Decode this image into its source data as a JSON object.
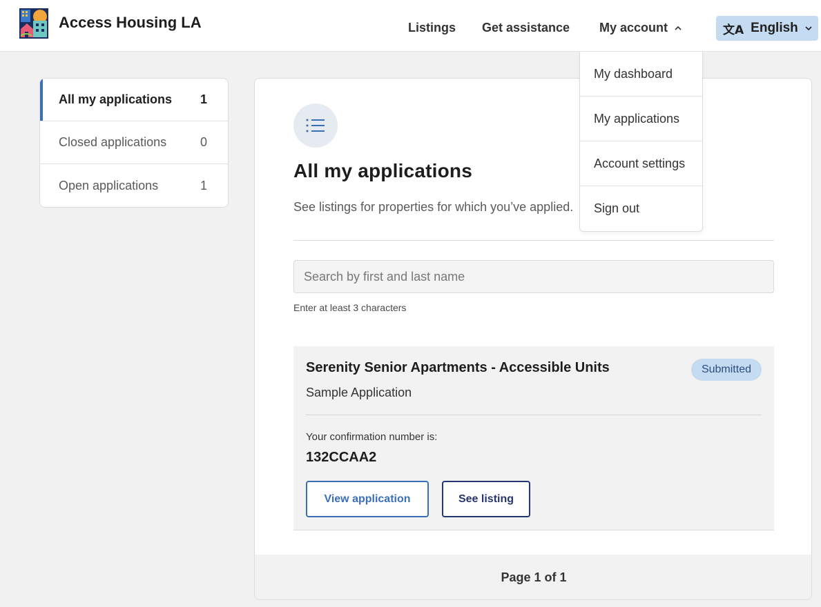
{
  "header": {
    "brand": "Access Housing LA",
    "nav": {
      "listings": "Listings",
      "get_assistance": "Get assistance",
      "my_account": "My account"
    },
    "language": "English",
    "language_icon": "translate-icon"
  },
  "account_menu": {
    "items": [
      {
        "label": "My dashboard"
      },
      {
        "label": "My applications"
      },
      {
        "label": "Account settings"
      },
      {
        "label": "Sign out"
      }
    ]
  },
  "sidebar": {
    "items": [
      {
        "label": "All my applications",
        "count": "1",
        "active": true
      },
      {
        "label": "Closed applications",
        "count": "0",
        "active": false
      },
      {
        "label": "Open applications",
        "count": "1",
        "active": false
      }
    ]
  },
  "main": {
    "icon": "list-icon",
    "title": "All my applications",
    "subtitle": "See listings for properties for which you’ve applied.",
    "search": {
      "placeholder": "Search by first and last name",
      "value": "",
      "hint": "Enter at least 3 characters"
    },
    "application": {
      "name": "Serenity Senior Apartments - Accessible Units",
      "status": "Submitted",
      "type": "Sample Application",
      "confirmation_label": "Your confirmation number is:",
      "confirmation_number": "132CCAA2",
      "view_button": "View application",
      "see_listing_button": "See listing"
    },
    "pagination": "Page 1 of 1"
  },
  "colors": {
    "accent": "#3a6fb8",
    "dark_button": "#253570",
    "badge_bg": "#c4dbf2",
    "language_bg": "#c4dbf2"
  }
}
